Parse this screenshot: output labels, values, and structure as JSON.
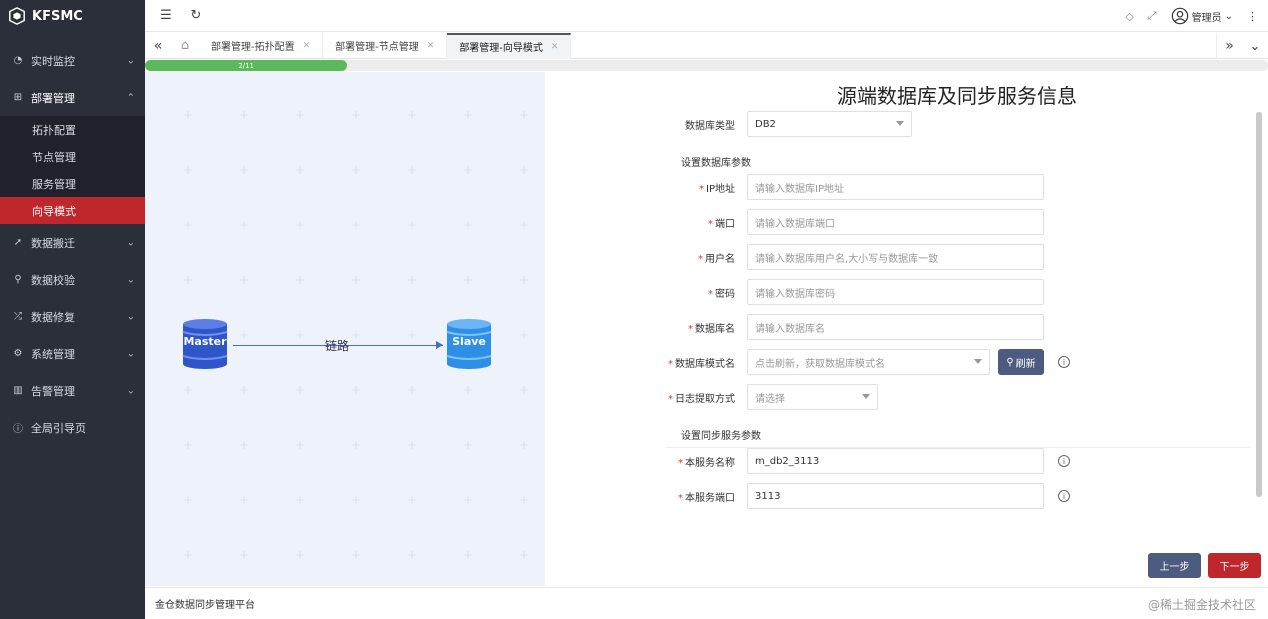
{
  "app": {
    "name": "KFSMC"
  },
  "sidebar": {
    "items": [
      {
        "label": "实时监控",
        "icon": "dashboard-icon"
      },
      {
        "label": "部署管理",
        "icon": "deploy-icon"
      },
      {
        "label": "数据搬迁",
        "icon": "migrate-icon"
      },
      {
        "label": "数据校验",
        "icon": "search-icon"
      },
      {
        "label": "数据修复",
        "icon": "repair-icon"
      },
      {
        "label": "系统管理",
        "icon": "gear-icon"
      },
      {
        "label": "告警管理",
        "icon": "alarm-icon"
      },
      {
        "label": "全局引导页",
        "icon": "info-icon"
      }
    ],
    "subitems": [
      "拓扑配置",
      "节点管理",
      "服务管理",
      "向导模式"
    ]
  },
  "topbar": {
    "user": "管理员"
  },
  "tabs": [
    {
      "label": "部署管理-拓扑配置"
    },
    {
      "label": "部署管理-节点管理"
    },
    {
      "label": "部署管理-向导模式"
    }
  ],
  "progress": {
    "label": "2/11",
    "fraction": 0.18
  },
  "diagram": {
    "master": "Master",
    "slave": "Slave",
    "link": "链路"
  },
  "form": {
    "title": "源端数据库及同步服务信息",
    "db_type_label": "数据库类型",
    "db_type_value": "DB2",
    "section1": "设置数据库参数",
    "ip_label": "IP地址",
    "ip_placeholder": "请输入数据库IP地址",
    "port_label": "端口",
    "port_placeholder": "请输入数据库端口",
    "user_label": "用户名",
    "user_placeholder": "请输入数据库用户名,大小写与数据库一致",
    "pwd_label": "密码",
    "pwd_placeholder": "请输入数据库密码",
    "dbname_label": "数据库名",
    "dbname_placeholder": "请输入数据库名",
    "schema_label": "数据库模式名",
    "schema_placeholder": "点击刷新，获取数据库模式名",
    "refresh_label": "刷新",
    "log_label": "日志提取方式",
    "log_placeholder": "请选择",
    "section2": "设置同步服务参数",
    "svc_name_label": "本服务名称",
    "svc_name_value": "m_db2_3113",
    "svc_port_label": "本服务端口",
    "svc_port_value": "3113",
    "prev": "上一步",
    "next": "下一步"
  },
  "footer": {
    "text": "金仓数据同步管理平台",
    "right": "@稀土掘金技术社区"
  },
  "colors": {
    "accent": "#c0272d",
    "sidebar_bg": "#2b2f3a",
    "primary_btn": "#4d5b80",
    "progress": "#5cb85c"
  }
}
